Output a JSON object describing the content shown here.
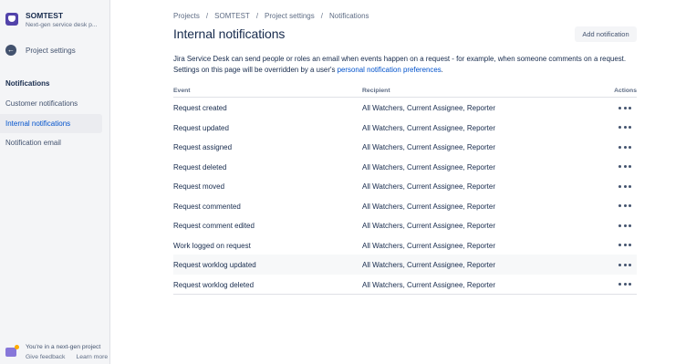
{
  "sidebar": {
    "project_name": "SOMTEST",
    "project_type": "Next-gen service desk p...",
    "back_label": "Project settings",
    "section_title": "Notifications",
    "items": [
      {
        "label": "Customer notifications"
      },
      {
        "label": "Internal notifications",
        "active": true
      },
      {
        "label": "Notification email"
      }
    ],
    "footer": {
      "text": "You're in a next-gen project",
      "give_feedback": "Give feedback",
      "learn_more": "Learn more"
    }
  },
  "breadcrumb": [
    "Projects",
    "SOMTEST",
    "Project settings",
    "Notifications"
  ],
  "page": {
    "title": "Internal notifications",
    "add_button": "Add notification",
    "description": "Jira Service Desk can send people or roles an email when events happen on a request - for example, when someone comments on a request. Settings on this page will be overridden by a user's",
    "description_link": "personal notification preferences",
    "description_end": "."
  },
  "table": {
    "headers": {
      "event": "Event",
      "recipient": "Recipient",
      "actions": "Actions"
    },
    "rows": [
      {
        "event": "Request created",
        "recipient": "All Watchers, Current Assignee, Reporter"
      },
      {
        "event": "Request updated",
        "recipient": "All Watchers, Current Assignee, Reporter"
      },
      {
        "event": "Request assigned",
        "recipient": "All Watchers, Current Assignee, Reporter"
      },
      {
        "event": "Request deleted",
        "recipient": "All Watchers, Current Assignee, Reporter"
      },
      {
        "event": "Request moved",
        "recipient": "All Watchers, Current Assignee, Reporter"
      },
      {
        "event": "Request commented",
        "recipient": "All Watchers, Current Assignee, Reporter"
      },
      {
        "event": "Request comment edited",
        "recipient": "All Watchers, Current Assignee, Reporter"
      },
      {
        "event": "Work logged on request",
        "recipient": "All Watchers, Current Assignee, Reporter"
      },
      {
        "event": "Request worklog updated",
        "recipient": "All Watchers, Current Assignee, Reporter",
        "hover": true
      },
      {
        "event": "Request worklog deleted",
        "recipient": "All Watchers, Current Assignee, Reporter"
      }
    ]
  },
  "colors": {
    "link": "#0052cc",
    "sidebar_bg": "#f4f5f7",
    "active_bg": "#ebecf0"
  },
  "icons": {
    "back": "arrow-left-icon",
    "project": "project-avatar-icon",
    "more": "more-icon",
    "footer": "next-gen-icon"
  }
}
